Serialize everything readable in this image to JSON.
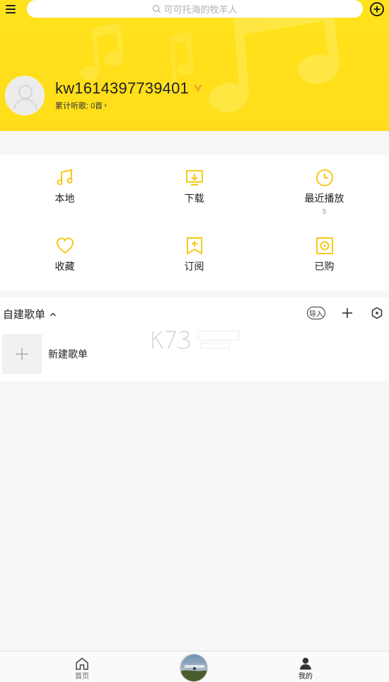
{
  "search": {
    "placeholder": "可可托海的牧羊人",
    "icon": "search-icon"
  },
  "header": {
    "menu_icon": "menu-icon",
    "add_icon": "add-circle-icon",
    "accent": "#ffe21c"
  },
  "profile": {
    "username": "kw1614397739401",
    "listen_label": "累计听歌:",
    "listen_count": "0首",
    "chevron": "›"
  },
  "grid": [
    {
      "label": "本地",
      "icon": "music-note-icon",
      "count": ""
    },
    {
      "label": "下载",
      "icon": "download-icon",
      "count": ""
    },
    {
      "label": "最近播放",
      "icon": "clock-icon",
      "count": "5"
    },
    {
      "label": "收藏",
      "icon": "heart-icon",
      "count": ""
    },
    {
      "label": "订阅",
      "icon": "bookmark-plus-icon",
      "count": ""
    },
    {
      "label": "已购",
      "icon": "purchased-icon",
      "count": ""
    }
  ],
  "playlists": {
    "title": "自建歌单",
    "import_label": "导入",
    "new_label": "新建歌单"
  },
  "nav": [
    {
      "label": "首页",
      "icon": "home-icon"
    },
    {
      "label": "我的",
      "icon": "person-icon"
    }
  ],
  "colors": {
    "icon_yellow": "#f7c91a",
    "text": "#222222"
  }
}
